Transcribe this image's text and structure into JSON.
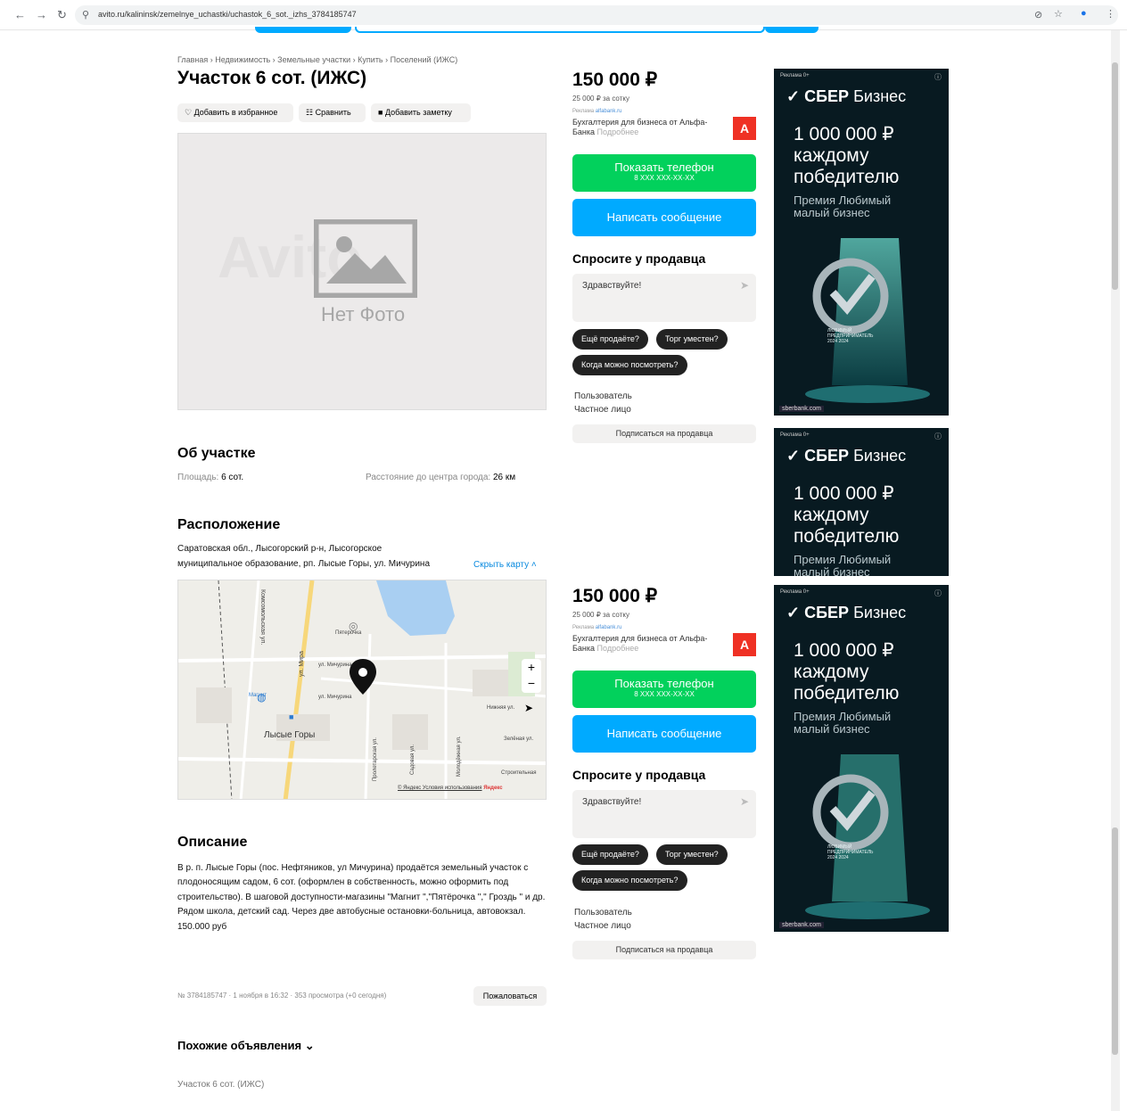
{
  "browser": {
    "url": "avito.ru/kalininsk/zemelnye_uchastki/uchastok_6_sot._izhs_3784185747"
  },
  "breadcrumbs": "Главная › Недвижимость › Земельные участки › Купить › Поселений (ИЖС)",
  "title": "Участок 6 сот. (ИЖС)",
  "actions": {
    "favorite": "Добавить в избранное",
    "compare": "Сравнить",
    "note": "Добавить заметку"
  },
  "photo": {
    "placeholder": "Нет Фото",
    "watermark": "Avito"
  },
  "about": {
    "heading": "Об участке",
    "area_label": "Площадь:",
    "area_value": "6 сот.",
    "distance_label": "Расстояние до центра города:",
    "distance_value": "26 км"
  },
  "location": {
    "heading": "Расположение",
    "address_line1": "Саратовская обл., Лысогорский р-н, Лысогорское",
    "address_line2": "муниципальное образование, рп. Лысые Горы, ул. Мичурина",
    "hide_map": "Скрыть карту ˄"
  },
  "map": {
    "labels": {
      "street_michurina": "ул. Мичурина",
      "street_michurina2": "ул. Мичурина",
      "street_mira": "ул. Мира",
      "street_komsomolskaya": "Комсомольская ул.",
      "street_nizhnyaya": "Нижняя ул.",
      "street_zelenaya": "Зелёная ул.",
      "street_stroitelnaya": "Строительная",
      "street_proletarskaya": "Пролетарская ул.",
      "street_sadovaya": "Садовая ул.",
      "street_molodezhnaya": "Молодёжная ул.",
      "town": "Лысые Горы",
      "pyaterochka": "Пятерочка",
      "magnit": "Магнит"
    },
    "footer": "© Яндекс Условия использования",
    "yandex": "Яндекс",
    "zoom_in": "+",
    "zoom_out": "−"
  },
  "description": {
    "heading": "Описание",
    "text": "В р. п. Лысые Горы (пос. Нефтяников, ул Мичурина) продаётся земельный участок с плодоносящим садом, 6 сот. (оформлен в собственность, можно оформить под строительство). В шаговой доступности-магазины \"Магнит \",\"Пятёрочка \",\" Гроздь \" и др. Рядом школа, детский сад. Через две автобусные остановки-больница, автовокзал.",
    "price_text": "150.000 руб"
  },
  "meta": {
    "info": "№ 3784185747 · 1 ноября в 16:32 · 353 просмотра (+0 сегодня)",
    "complain": "Пожаловаться"
  },
  "similar": {
    "heading": "Похожие объявления ⌄",
    "item": "Участок 6 сот. (ИЖС)"
  },
  "panel": {
    "price": "150 000 ₽",
    "per_sotka": "25 000 ₽ за сотку",
    "ad_label": "Реклама",
    "ad_domain": "alfabank.ru",
    "ad_text": "Бухгалтерия для бизнеса от Альфа-Банка",
    "ad_more": "Подробнее",
    "alfa_logo": "А",
    "show_phone": "Показать телефон",
    "phone_mask": "8 XXX XXX-XX-XX",
    "write_message": "Написать сообщение",
    "ask_heading": "Спросите у продавца",
    "ask_text": "Здравствуйте!",
    "chips": [
      "Ещё продаёте?",
      "Торг уместен?",
      "Когда можно посмотреть?"
    ],
    "seller_type": "Пользователь",
    "seller_kind": "Частное лицо",
    "subscribe": "Подписаться на продавца"
  },
  "banner": {
    "ad_label": "Реклама",
    "age": "0+",
    "brand": "СБЕР",
    "brand_suffix": "Бизнес",
    "amount": "1 000 000 ₽",
    "line2": "каждому",
    "line3": "победителю",
    "prize": "Премия Любимый малый бизнес",
    "site": "sberbank.com",
    "trophy1": "ЛЮБИМЫЙ ПРЕДПРИНИМАТЕЛЬ",
    "trophy2": "2024 2024"
  },
  "colors": {
    "green": "#02d15c",
    "blue": "#00aaff",
    "ad_bg": "#081a21",
    "alfa": "#ef3124"
  }
}
